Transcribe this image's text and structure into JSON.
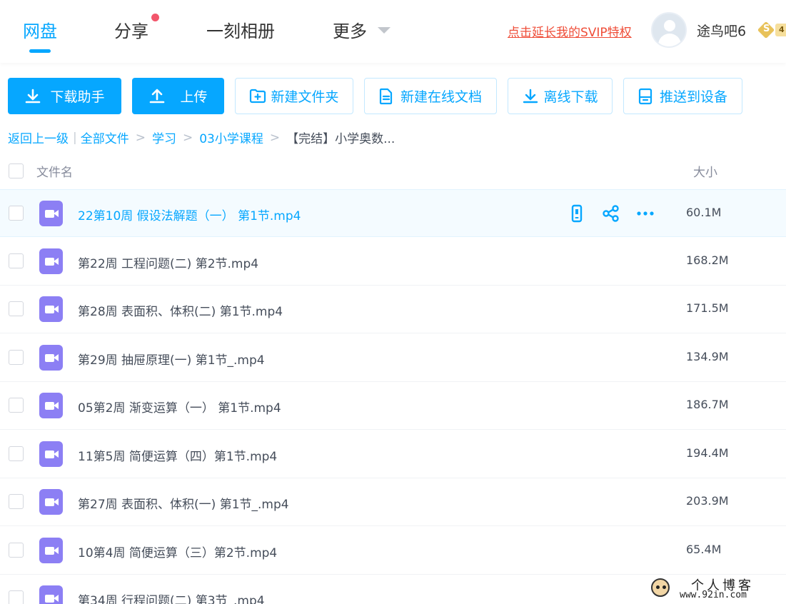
{
  "topnav": {
    "tabs": [
      {
        "label": "网盘",
        "active": true
      },
      {
        "label": "分享",
        "has_dot": true
      },
      {
        "label": "一刻相册"
      },
      {
        "label": "更多",
        "has_dropdown": true
      }
    ],
    "promo_link": "点击延长我的SVIP特权",
    "username": "途鸟吧6",
    "vip_level_badge": "4"
  },
  "toolbar": {
    "download_helper": "下载助手",
    "upload": "上传",
    "new_folder": "新建文件夹",
    "new_online_doc": "新建在线文档",
    "offline_download": "离线下载",
    "push_to_device": "推送到设备"
  },
  "breadcrumb": {
    "back": "返回上一级",
    "all_files": "全部文件",
    "level1": "学习",
    "level2": "03小学课程",
    "current": "【完结】小学奥数..."
  },
  "table": {
    "col_name": "文件名",
    "col_size": "大小",
    "rows": [
      {
        "name": "22第10周 假设法解题（一） 第1节.mp4",
        "size": "60.1M",
        "hovered": true
      },
      {
        "name": "第22周 工程问题(二) 第2节.mp4",
        "size": "168.2M"
      },
      {
        "name": "第28周 表面积、体积(二) 第1节.mp4",
        "size": "171.5M"
      },
      {
        "name": "第29周 抽屉原理(一) 第1节_.mp4",
        "size": "134.9M"
      },
      {
        "name": "05第2周 渐变运算（一） 第1节.mp4",
        "size": "186.7M"
      },
      {
        "name": "11第5周 简便运算（四）第1节.mp4",
        "size": "194.4M"
      },
      {
        "name": "第27周 表面积、体积(一) 第1节_.mp4",
        "size": "203.9M"
      },
      {
        "name": "10第4周 简便运算（三）第2节.mp4",
        "size": "65.4M"
      },
      {
        "name": "第34周 行程问题(二) 第3节_.mp4",
        "size": ""
      }
    ],
    "row_icon": "video-file-icon",
    "row_actions": [
      "phone-icon",
      "share-icon",
      "more-icon"
    ]
  },
  "watermark": {
    "title": "个人博客",
    "url": "www.92in.com"
  },
  "colors": {
    "accent": "#06a7ff",
    "promo": "#ef4d38",
    "video_icon": "#8c7ff4",
    "notification_dot": "#f2566b"
  }
}
